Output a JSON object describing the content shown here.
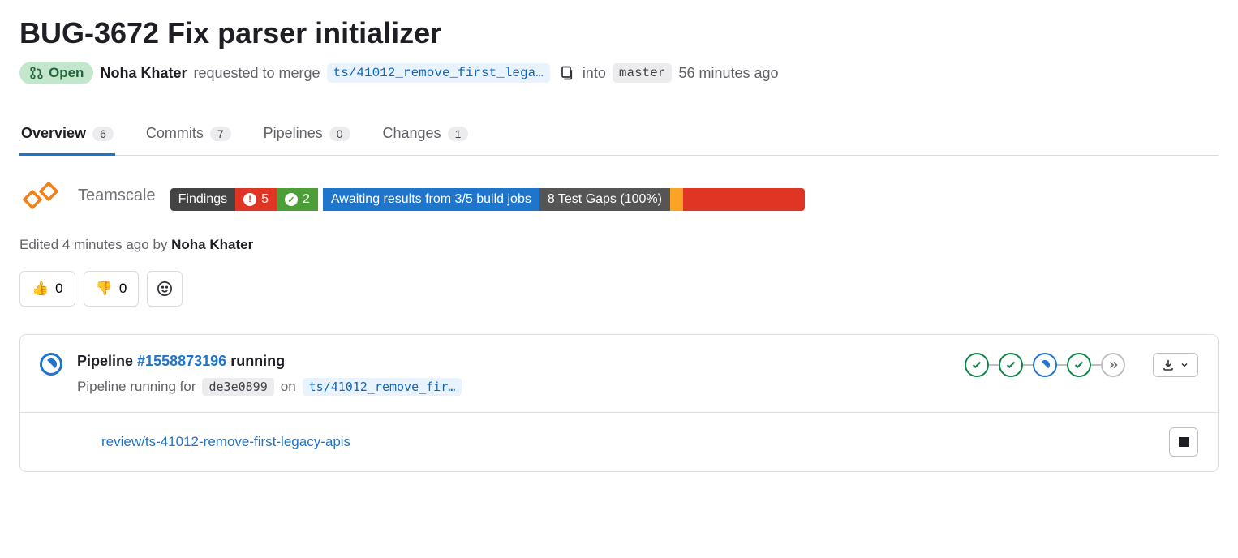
{
  "title": "BUG-3672 Fix parser initializer",
  "status": "Open",
  "author": "Noha Khater",
  "merge_text": "requested to merge",
  "source_branch": "ts/41012_remove_first_lega…",
  "into_text": "into",
  "target_branch": "master",
  "age": "56 minutes ago",
  "tabs": {
    "overview": {
      "label": "Overview",
      "count": "6"
    },
    "commits": {
      "label": "Commits",
      "count": "7"
    },
    "pipelines": {
      "label": "Pipelines",
      "count": "0"
    },
    "changes": {
      "label": "Changes",
      "count": "1"
    }
  },
  "teamscale": {
    "name": "Teamscale",
    "findings_label": "Findings",
    "red_count": "5",
    "green_count": "2",
    "awaiting": "Awaiting results from 3/5 build jobs",
    "test_gaps": "8 Test Gaps (100%)"
  },
  "edited": {
    "prefix": "Edited 4 minutes ago by",
    "author": "Noha Khater"
  },
  "reactions": {
    "thumbs_up": "0",
    "thumbs_down": "0"
  },
  "pipeline": {
    "prefix": "Pipeline",
    "id": "#1558873196",
    "suffix": "running",
    "sub_prefix": "Pipeline running for",
    "commit": "de3e0899",
    "on": "on",
    "branch": "ts/41012_remove_fir…",
    "environment": "review/ts-41012-remove-first-legacy-apis"
  }
}
